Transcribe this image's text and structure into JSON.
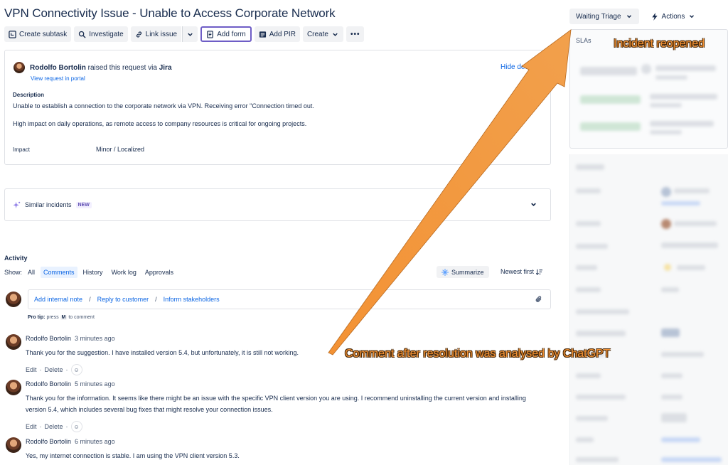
{
  "issue": {
    "title": "VPN Connectivity Issue - Unable to Access Corporate Network"
  },
  "toolbar": {
    "create_subtask": "Create subtask",
    "investigate": "Investigate",
    "link_issue": "Link issue",
    "add_form": "Add form",
    "add_pir": "Add PIR",
    "create": "Create"
  },
  "header_right": {
    "status": "Waiting Triage",
    "actions": "Actions"
  },
  "request": {
    "reporter": "Rodolfo Bortolin",
    "raised_text": "raised this request via",
    "channel": "Jira",
    "view_portal": "View request in portal",
    "hide_details": "Hide det",
    "description_label": "Description",
    "description_line1": "Unable to establish a connection to the corporate network via VPN. Receiving error \"Connection timed out.",
    "description_line2": "High impact on daily operations, as remote access to company resources is critical for ongoing projects.",
    "impact_label": "Impact",
    "impact_value": "Minor / Localized"
  },
  "similar": {
    "label": "Similar incidents",
    "badge": "NEW"
  },
  "activity": {
    "title": "Activity",
    "show_label": "Show:",
    "filters": [
      "All",
      "Comments",
      "History",
      "Work log",
      "Approvals"
    ],
    "active_filter": "Comments",
    "summarize": "Summarize",
    "sort": "Newest first"
  },
  "comment_box": {
    "add_internal_note": "Add internal note",
    "reply_to_customer": "Reply to customer",
    "inform_stakeholders": "Inform stakeholders",
    "separator": "/",
    "protip_prefix": "Pro tip:",
    "protip_press": "press",
    "protip_key": "M",
    "protip_suffix": "to comment"
  },
  "comments": [
    {
      "author": "Rodolfo Bortolin",
      "time": "3 minutes ago",
      "body": "Thank you for the suggestion. I have installed version 5.4, but unfortunately, it is still not working.",
      "edit": "Edit",
      "delete": "Delete"
    },
    {
      "author": "Rodolfo Bortolin",
      "time": "5 minutes ago",
      "body": "Thank you for the information. It seems like there might be an issue with the specific VPN client version you are using. I recommend uninstalling the current version and installing version 5.4, which includes several bug fixes that might resolve your connection issues.",
      "edit": "Edit",
      "delete": "Delete"
    },
    {
      "author": "Rodolfo Bortolin",
      "time": "6 minutes ago",
      "body": "Yes, my internet connection is stable. I am using the VPN client version 5.3."
    }
  ],
  "sidebar": {
    "slas_title": "SLAs"
  },
  "annotations": {
    "top": "Incident reopened",
    "bottom": "Comment after resolution was analysed by ChatGPT",
    "color": "#f39234"
  }
}
